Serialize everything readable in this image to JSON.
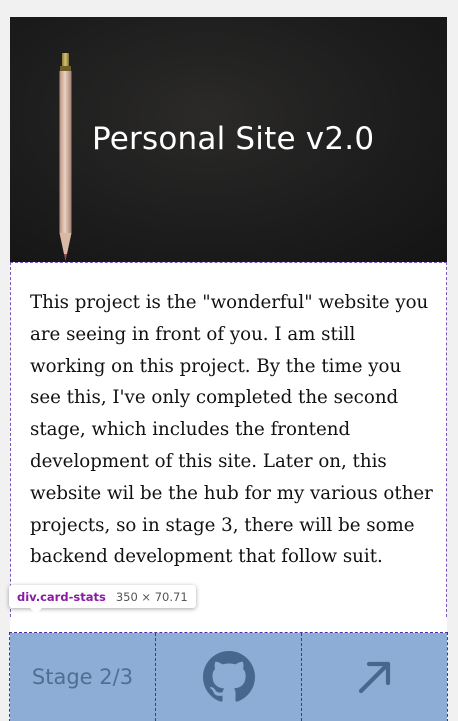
{
  "card": {
    "title": "Personal Site v2.0",
    "description": "This project is the \"wonderful\" website you are seeing in front of you. I am still working on this project. By the time you see this, I've only completed the second stage, which includes the frontend development of this site. Later on, this website wil be the hub for my various other projects, so in stage 3, there will be some backend development that follow suit."
  },
  "inspector": {
    "tag": "div.card-stats",
    "dimensions": "350 × 70.71"
  },
  "stats": {
    "stage_label": "Stage 2/3",
    "github_icon": "github-icon",
    "link_icon": "arrow-up-right-icon"
  },
  "colors": {
    "stats_background": "#8eadd6",
    "stats_icon": "#46688f",
    "devtools_outline": "#4a2ea3"
  }
}
